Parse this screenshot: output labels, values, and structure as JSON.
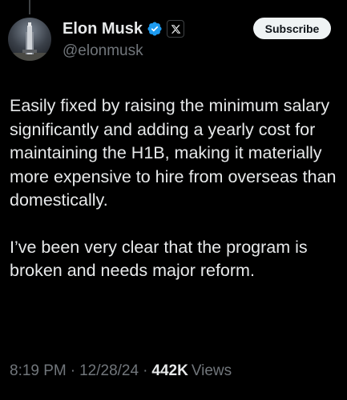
{
  "author": {
    "display_name": "Elon Musk",
    "handle": "@elonmusk",
    "verified": true,
    "badge_icon": "x-logo-icon",
    "verified_color": "#1d9bf0"
  },
  "subscribe_button": {
    "label": "Subscribe"
  },
  "tweet": {
    "paragraphs": [
      "Easily fixed by raising the minimum salary significantly and adding a yearly cost for maintaining the H1B, making it materially more expensive to hire from overseas than domestically.",
      "I’ve been very clear that the program is broken and needs major reform."
    ]
  },
  "meta": {
    "time": "8:19 PM",
    "separator": "·",
    "date": "12/28/24",
    "views_count": "442K",
    "views_label": "Views"
  },
  "colors": {
    "background": "#000000",
    "text_primary": "#e7e9ea",
    "text_secondary": "#71767b",
    "button_bg": "#eff3f4",
    "button_text": "#0f1419"
  }
}
